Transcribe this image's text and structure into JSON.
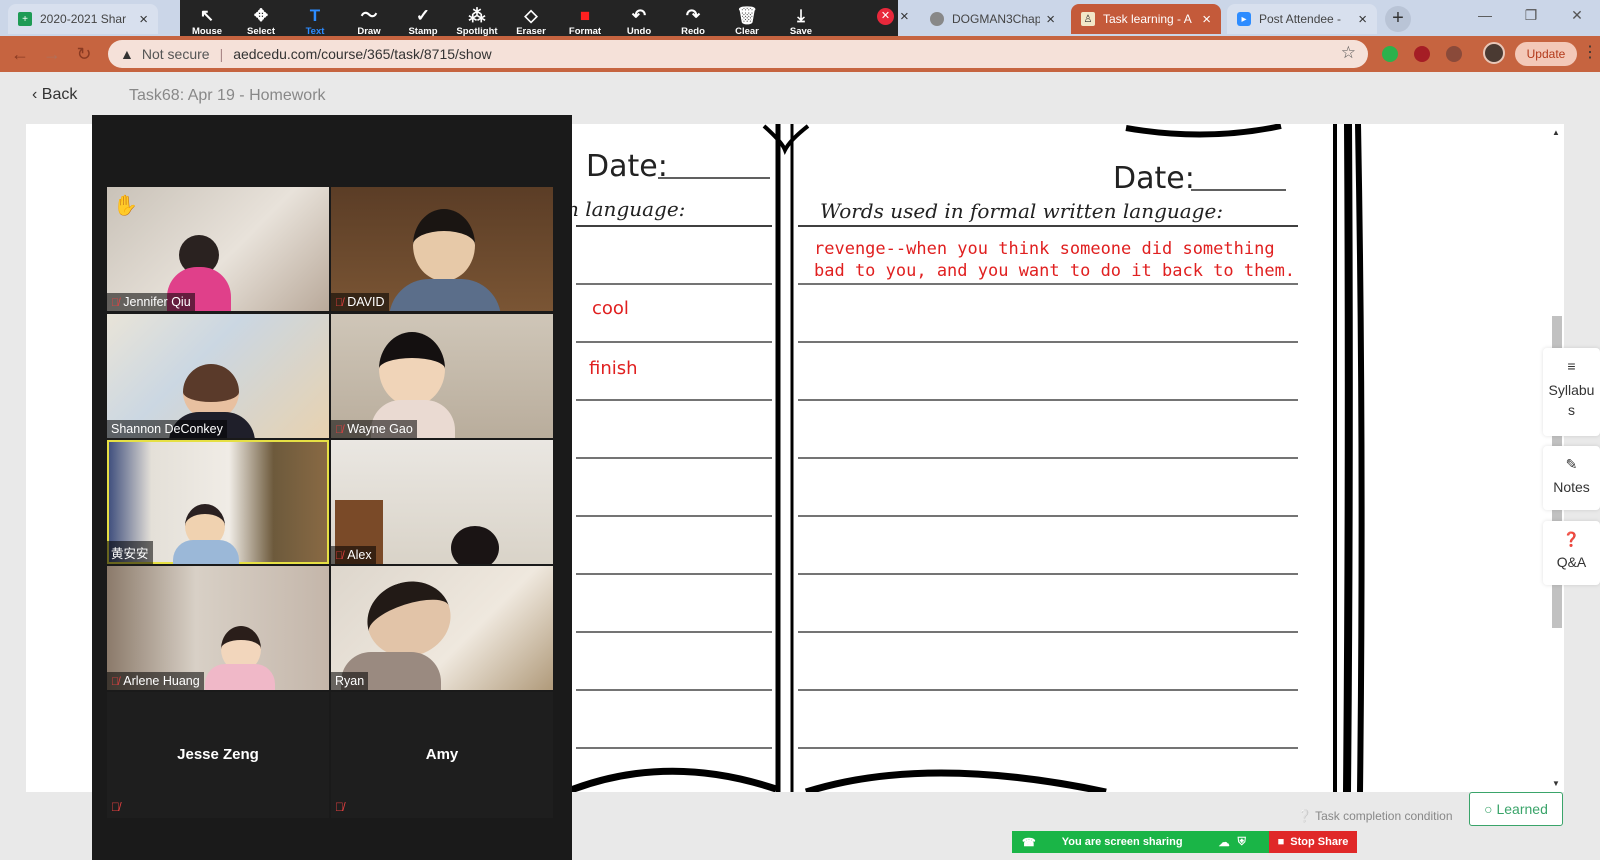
{
  "browser": {
    "tabs": [
      {
        "label": "2020-2021 Shar",
        "icon": "sheets-icon"
      },
      {
        "label": "DOGMAN3Chap",
        "icon": "globe-icon"
      },
      {
        "label": "Task learning - A",
        "icon": "page-icon"
      },
      {
        "label": "Post Attendee -",
        "icon": "zoom-icon"
      }
    ],
    "security": "Not secure",
    "url": "aedcedu.com/course/365/task/8715/show",
    "update_label": "Update"
  },
  "annotate_toolbar": {
    "tools": [
      {
        "label": "Mouse",
        "icon": "cursor-icon",
        "glyph": "↖"
      },
      {
        "label": "Select",
        "icon": "move-icon",
        "glyph": "✥"
      },
      {
        "label": "Text",
        "icon": "text-icon",
        "glyph": "T",
        "selected": true
      },
      {
        "label": "Draw",
        "icon": "squiggle-icon",
        "glyph": "〜"
      },
      {
        "label": "Stamp",
        "icon": "check-icon",
        "glyph": "✓"
      },
      {
        "label": "Spotlight",
        "icon": "wand-icon",
        "glyph": "⁂"
      },
      {
        "label": "Eraser",
        "icon": "eraser-icon",
        "glyph": "◇"
      },
      {
        "label": "Format",
        "icon": "format-swatch-icon",
        "glyph": "■"
      },
      {
        "label": "Undo",
        "icon": "undo-icon",
        "glyph": "↶"
      },
      {
        "label": "Redo",
        "icon": "redo-icon",
        "glyph": "↷"
      },
      {
        "label": "Clear",
        "icon": "trash-icon",
        "glyph": "🗑"
      },
      {
        "label": "Save",
        "icon": "save-icon",
        "glyph": "⤓"
      }
    ],
    "format_color": "#ff2020"
  },
  "page": {
    "back_label": "Back",
    "breadcrumb": "Task68:  Apr 19 - Homework",
    "task_condition": "Task completion condition",
    "learned_label": "Learned"
  },
  "worksheet": {
    "left_date": "Date:",
    "left_header": "n language:",
    "right_date": "Date:",
    "right_header": "Words used in formal written language:",
    "left_entries": [
      "cool",
      "finish"
    ],
    "right_entry_line1": "revenge--when you think someone did something",
    "right_entry_line2": "bad to you, and you want to do it back to them.",
    "ink_color": "#e02020"
  },
  "side_panels": [
    {
      "label": "Syllabus",
      "icon": "list-icon"
    },
    {
      "label": "Notes",
      "icon": "pencil-icon"
    },
    {
      "label": "Q&A",
      "icon": "question-icon"
    }
  ],
  "zoom": {
    "participants": [
      {
        "name": "Jennifer Qiu",
        "muted": true,
        "hand": true
      },
      {
        "name": "DAVID",
        "muted": true
      },
      {
        "name": "Shannon DeConkey",
        "muted": false
      },
      {
        "name": "Wayne Gao",
        "muted": true
      },
      {
        "name": "黄安安",
        "muted": false,
        "speaking": true
      },
      {
        "name": "Alex",
        "muted": true
      },
      {
        "name": "Arlene Huang",
        "muted": true
      },
      {
        "name": "Ryan",
        "muted": false
      }
    ],
    "video_off": [
      {
        "name": "Jesse Zeng"
      },
      {
        "name": "Amy"
      }
    ],
    "share_text": "You are screen sharing",
    "stop_share": "Stop Share"
  }
}
